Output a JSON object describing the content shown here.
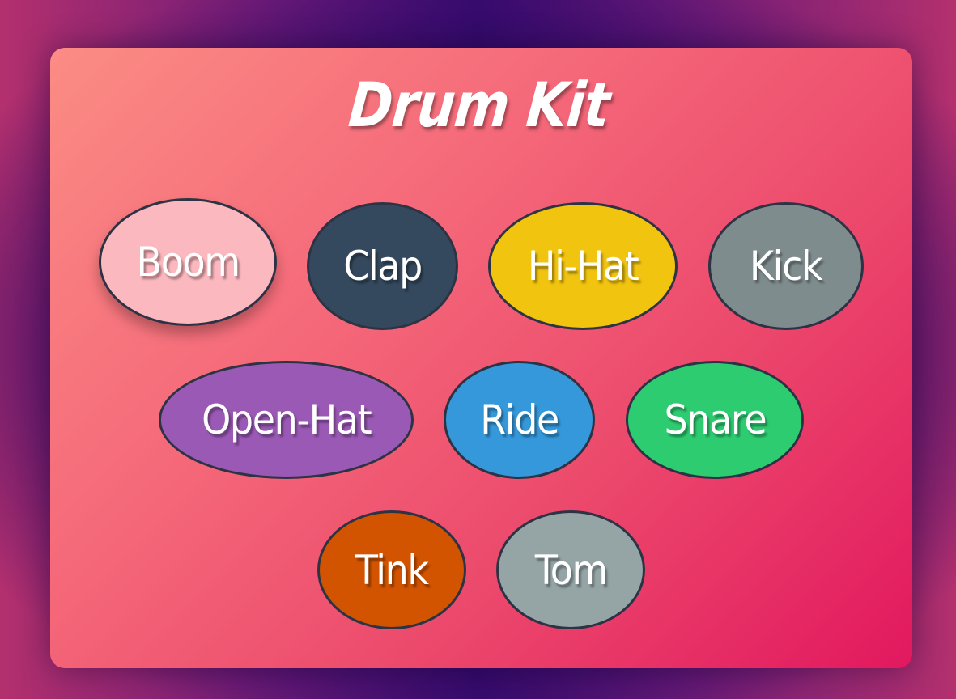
{
  "app": {
    "title": "Drum Kit"
  },
  "pads": [
    {
      "label": "Boom",
      "color": "#fcb8bf"
    },
    {
      "label": "Clap",
      "color": "#34495e"
    },
    {
      "label": "Hi-Hat",
      "color": "#f1c40f"
    },
    {
      "label": "Kick",
      "color": "#7f8c8d"
    },
    {
      "label": "Open-Hat",
      "color": "#9b59b6"
    },
    {
      "label": "Ride",
      "color": "#3498db"
    },
    {
      "label": "Snare",
      "color": "#2ecc71"
    },
    {
      "label": "Tink",
      "color": "#d35400"
    },
    {
      "label": "Tom",
      "color": "#95a5a6"
    }
  ],
  "theme": {
    "card_gradient_start": "#fb8c84",
    "card_gradient_end": "#e2185f",
    "pad_border": "#2c3345",
    "background": "#3a0c70"
  }
}
